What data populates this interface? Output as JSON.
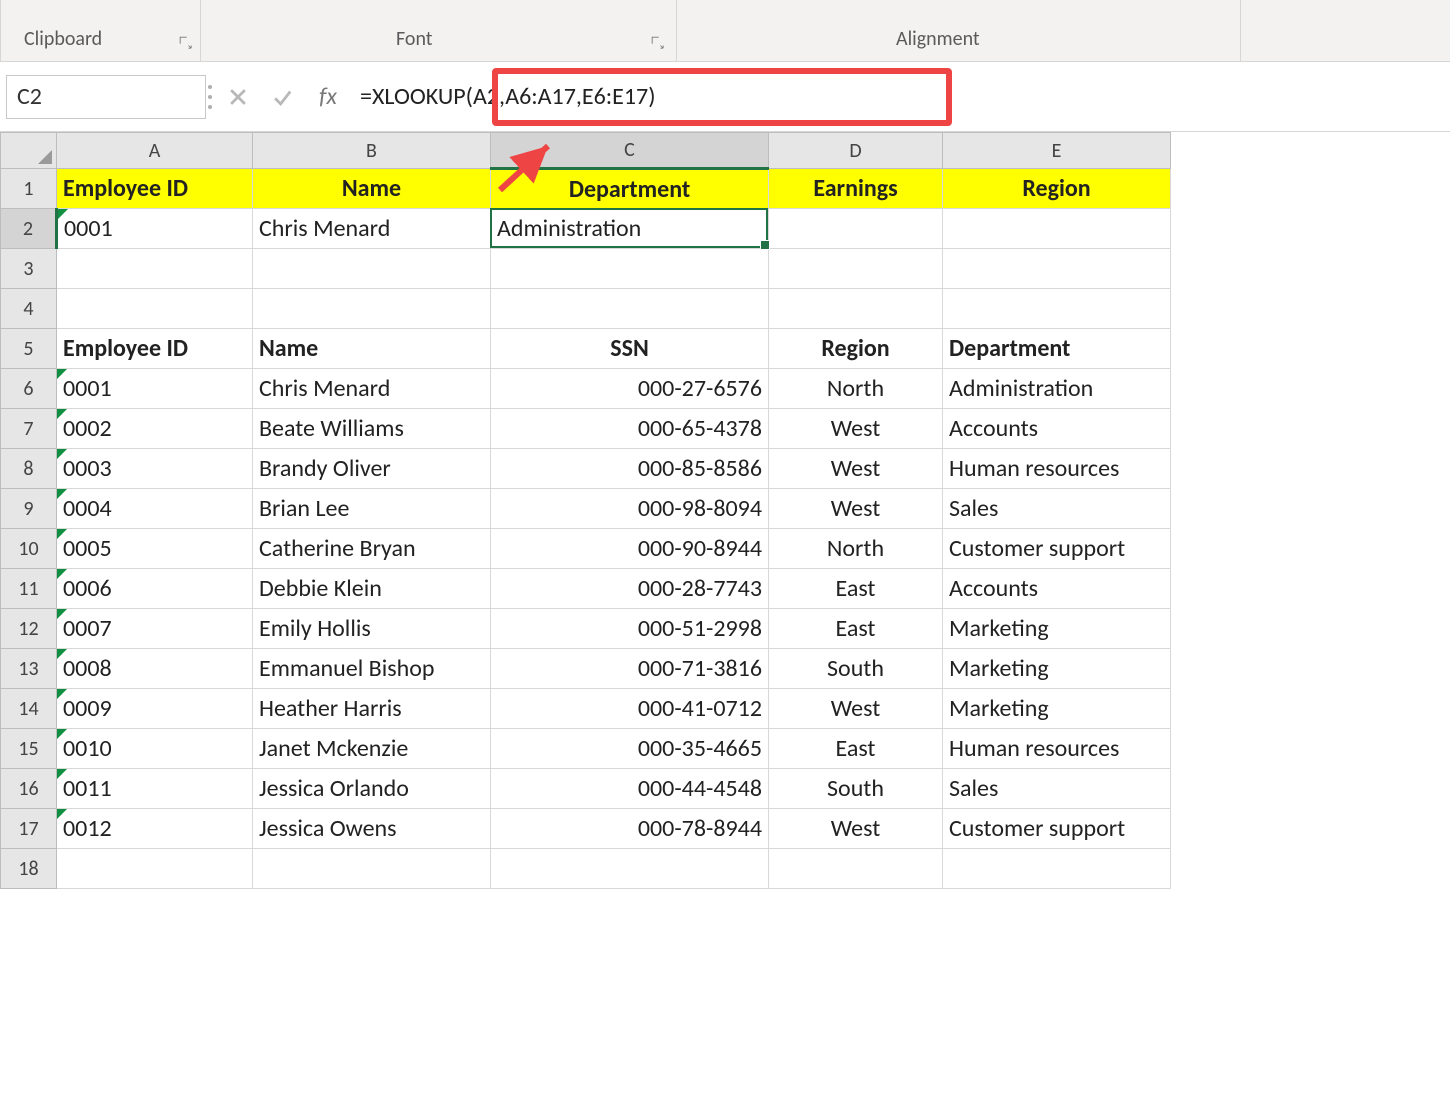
{
  "ribbon": {
    "groups": {
      "clipboard": "Clipboard",
      "font": "Font",
      "alignment": "Alignment"
    }
  },
  "formula_bar": {
    "name_box": "C2",
    "fx_label": "fx",
    "formula": "=XLOOKUP(A2,A6:A17,E6:E17)"
  },
  "columns": {
    "A": "A",
    "B": "B",
    "C": "C",
    "D": "D",
    "E": "E"
  },
  "row_numbers": [
    "1",
    "2",
    "3",
    "4",
    "5",
    "6",
    "7",
    "8",
    "9",
    "10",
    "11",
    "12",
    "13",
    "14",
    "15",
    "16",
    "17",
    "18"
  ],
  "top_headers": {
    "A": "Employee ID",
    "B": "Name",
    "C": "Department",
    "D": "Earnings",
    "E": "Region"
  },
  "result_row": {
    "A": "0001",
    "B": "Chris Menard",
    "C": "Administration",
    "D": "",
    "E": ""
  },
  "table_headers": {
    "A": "Employee ID",
    "B": "Name",
    "C": "SSN",
    "D": "Region",
    "E": "Department"
  },
  "table_rows": [
    {
      "id": "0001",
      "name": "Chris Menard",
      "ssn": "000-27-6576",
      "region": "North",
      "dept": "Administration"
    },
    {
      "id": "0002",
      "name": "Beate Williams",
      "ssn": "000-65-4378",
      "region": "West",
      "dept": "Accounts"
    },
    {
      "id": "0003",
      "name": "Brandy Oliver",
      "ssn": "000-85-8586",
      "region": "West",
      "dept": "Human resources"
    },
    {
      "id": "0004",
      "name": "Brian Lee",
      "ssn": "000-98-8094",
      "region": "West",
      "dept": "Sales"
    },
    {
      "id": "0005",
      "name": "Catherine Bryan",
      "ssn": "000-90-8944",
      "region": "North",
      "dept": "Customer support"
    },
    {
      "id": "0006",
      "name": "Debbie Klein",
      "ssn": "000-28-7743",
      "region": "East",
      "dept": "Accounts"
    },
    {
      "id": "0007",
      "name": "Emily Hollis",
      "ssn": "000-51-2998",
      "region": "East",
      "dept": "Marketing"
    },
    {
      "id": "0008",
      "name": "Emmanuel Bishop",
      "ssn": "000-71-3816",
      "region": "South",
      "dept": "Marketing"
    },
    {
      "id": "0009",
      "name": "Heather Harris",
      "ssn": "000-41-0712",
      "region": "West",
      "dept": "Marketing"
    },
    {
      "id": "0010",
      "name": "Janet Mckenzie",
      "ssn": "000-35-4665",
      "region": "East",
      "dept": "Human resources"
    },
    {
      "id": "0011",
      "name": "Jessica Orlando",
      "ssn": "000-44-4548",
      "region": "South",
      "dept": "Sales"
    },
    {
      "id": "0012",
      "name": "Jessica Owens",
      "ssn": "000-78-8944",
      "region": "West",
      "dept": "Customer support"
    }
  ],
  "selection": {
    "cell": "C2"
  }
}
